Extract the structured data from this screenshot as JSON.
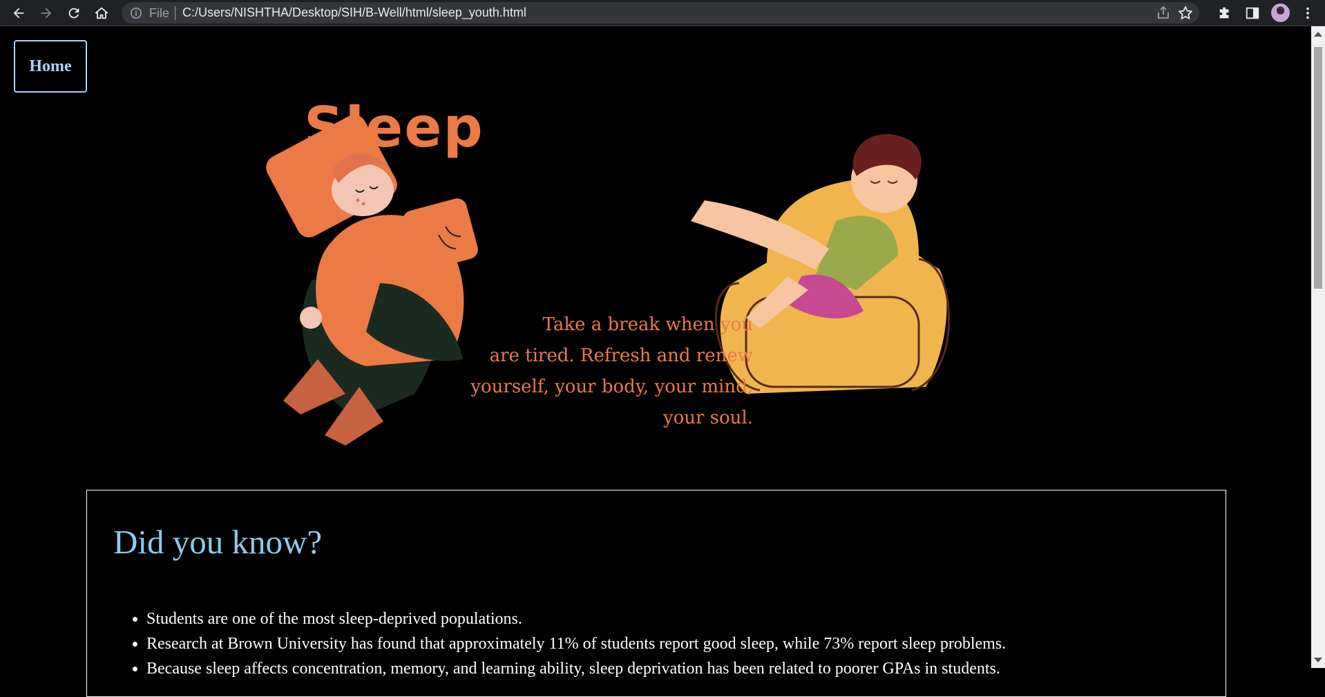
{
  "browser": {
    "scheme_label": "File",
    "url": "C:/Users/NISHTHA/Desktop/SIH/B-Well/html/sleep_youth.html",
    "icons": [
      "back-icon",
      "forward-icon",
      "reload-icon",
      "home-icon",
      "info-icon",
      "share-icon",
      "star-icon",
      "extensions-icon",
      "side-panel-icon",
      "avatar",
      "menu-icon"
    ]
  },
  "nav": {
    "home_label": "Home"
  },
  "hero": {
    "title": "Sleep",
    "tagline_lines": [
      "Take a break when you",
      "are tired. Refresh and renew",
      "yourself, your body, your mind,",
      "your soul."
    ],
    "accent_color": "#eb7a45"
  },
  "facts": {
    "heading": "Did you know?",
    "items": [
      "Students are one of the most sleep-deprived populations.",
      "Research at Brown University has found that approximately 11% of students report good sleep, while 73% report sleep problems.",
      "Because sleep affects concentration, memory, and learning ability, sleep deprivation has been related to poorer GPAs in students."
    ],
    "heading_color": "#8fc8ef"
  }
}
